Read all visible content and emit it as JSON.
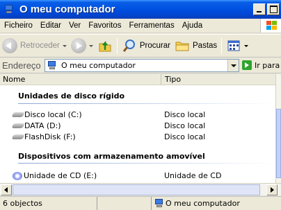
{
  "window": {
    "title": "O meu computador"
  },
  "menu": [
    "Ficheiro",
    "Editar",
    "Ver",
    "Favoritos",
    "Ferramentas",
    "Ajuda"
  ],
  "toolbar": {
    "back_label": "Retroceder",
    "search_label": "Procurar",
    "folders_label": "Pastas"
  },
  "address": {
    "label": "Endereço",
    "value": "O meu computador",
    "go_label": "Ir para"
  },
  "columns": {
    "name": "Nome",
    "type": "Tipo"
  },
  "groups": [
    {
      "title": "Unidades de disco rígido",
      "items": [
        {
          "name": "Disco local (C:)",
          "type": "Disco local",
          "icon": "hard-drive-icon"
        },
        {
          "name": "DATA (D:)",
          "type": "Disco local",
          "icon": "hard-drive-icon"
        },
        {
          "name": "FlashDisk (F:)",
          "type": "Disco local",
          "icon": "hard-drive-icon"
        }
      ]
    },
    {
      "title": "Dispositivos com armazenamento amovível",
      "items": [
        {
          "name": "Unidade de CD (E:)",
          "type": "Unidade de CD",
          "icon": "cd-drive-icon"
        }
      ]
    }
  ],
  "status": {
    "objects": "6 objectos",
    "location": "O meu computador"
  },
  "colors": {
    "title_bar": "#0054e3",
    "window_face": "#ece9d8",
    "group_rule": "#8aa4d6"
  }
}
